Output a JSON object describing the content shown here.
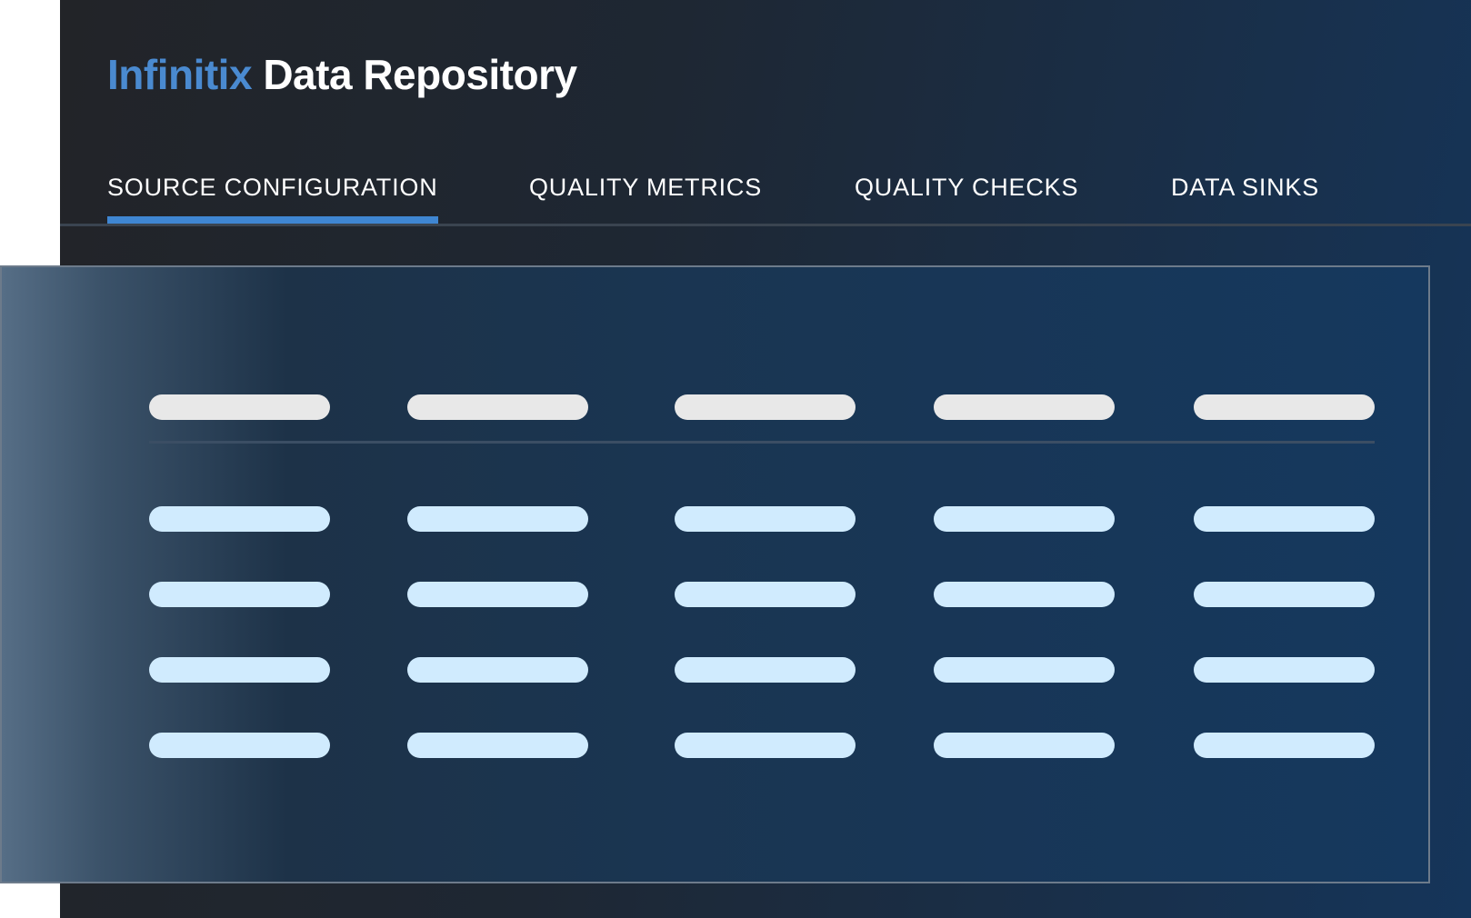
{
  "app": {
    "title_brand": "Infinitix",
    "title_rest": "Data Repository"
  },
  "tabs": [
    {
      "label": "SOURCE CONFIGURATION",
      "active": true
    },
    {
      "label": "QUALITY METRICS",
      "active": false
    },
    {
      "label": "QUALITY CHECKS",
      "active": false
    },
    {
      "label": "DATA SINKS",
      "active": false
    }
  ],
  "table": {
    "columns": 5,
    "header_rows": 1,
    "body_rows": 4,
    "content": "placeholder skeleton bars (no text shown)"
  },
  "colors": {
    "brand_accent": "#4a8ad0",
    "active_tab_underline": "#3f86d2",
    "header_placeholder": "#e8e8e8",
    "row_placeholder": "#d0ebfe"
  }
}
